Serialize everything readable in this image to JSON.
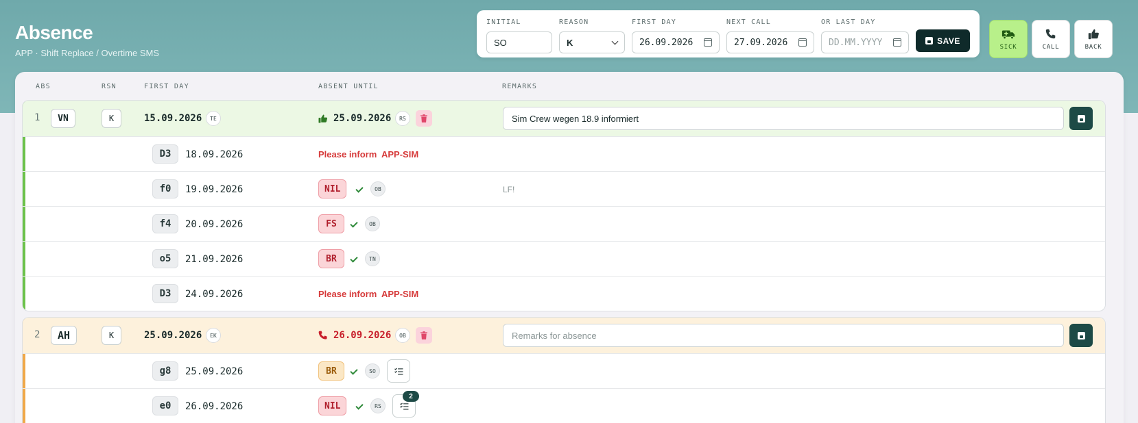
{
  "header": {
    "title": "Absence",
    "subtitle": "APP · Shift Replace / Overtime SMS"
  },
  "form": {
    "initial": {
      "label": "INITIAL",
      "value": "SO"
    },
    "reason": {
      "label": "REASON",
      "value": "K"
    },
    "first_day": {
      "label": "FIRST DAY",
      "value": "26.09.2026"
    },
    "next_call": {
      "label": "NEXT CALL",
      "value": "27.09.2026"
    },
    "last_day": {
      "label": "OR LAST DAY",
      "placeholder": "DD.MM.YYYY"
    },
    "save_label": "SAVE"
  },
  "actions": {
    "sick": "SICK",
    "call": "CALL",
    "back": "BACK"
  },
  "columns": {
    "abs": "ABS",
    "rsn": "RSN",
    "first_day": "FIRST DAY",
    "absent_until": "ABSENT UNTIL",
    "remarks": "REMARKS"
  },
  "absences": [
    {
      "index": "1",
      "abs": "VN",
      "rsn": "K",
      "first_day": "15.09.2026",
      "first_day_by": "TE",
      "until": "25.09.2026",
      "until_by": "RS",
      "remark": "Sim Crew wegen 18.9 informiert",
      "accent": "#6cc24a",
      "shifts": [
        {
          "code": "D3",
          "date": "18.09.2026",
          "inform": "Please inform",
          "inform_target": "APP-SIM"
        },
        {
          "code": "f0",
          "date": "19.09.2026",
          "status": "NIL",
          "by": "OB",
          "remark": "LF!"
        },
        {
          "code": "f4",
          "date": "20.09.2026",
          "status": "FS",
          "by": "OB"
        },
        {
          "code": "o5",
          "date": "21.09.2026",
          "status": "BR",
          "by": "TN"
        },
        {
          "code": "D3",
          "date": "24.09.2026",
          "inform": "Please inform",
          "inform_target": "APP-SIM"
        }
      ]
    },
    {
      "index": "2",
      "abs": "AH",
      "rsn": "K",
      "first_day": "25.09.2026",
      "first_day_by": "EK",
      "until": "26.09.2026",
      "until_by": "OB",
      "remark_placeholder": "Remarks for absence",
      "accent": "#f0a848",
      "shifts": [
        {
          "code": "g8",
          "date": "25.09.2026",
          "status": "BR",
          "by": "SO"
        },
        {
          "code": "e0",
          "date": "26.09.2026",
          "status": "NIL",
          "by": "RS",
          "badge": "2"
        }
      ]
    }
  ]
}
